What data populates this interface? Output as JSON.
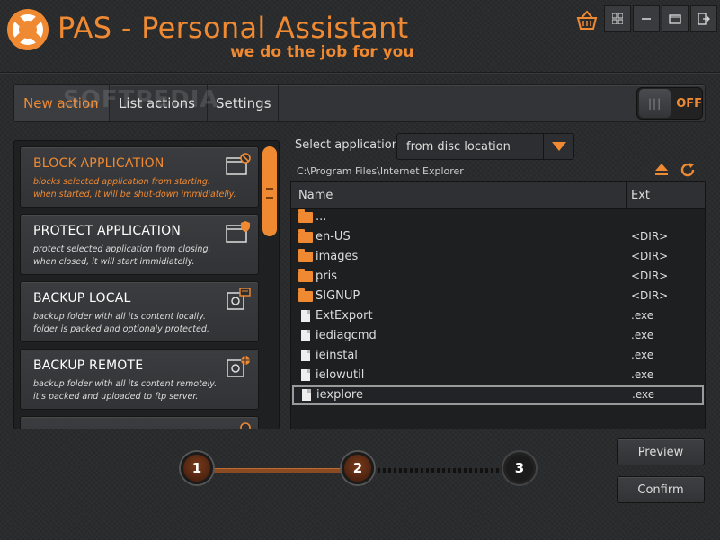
{
  "header": {
    "title": "PAS - Personal Assistant",
    "tagline": "we do the job for you"
  },
  "watermark": "SOFTPEDIA",
  "tabs": [
    {
      "label": "New action",
      "active": true
    },
    {
      "label": "List actions",
      "active": false
    },
    {
      "label": "Settings",
      "active": false
    }
  ],
  "toggle": {
    "state": "OFF",
    "grip": "|||"
  },
  "actions": [
    {
      "title": "BLOCK APPLICATION",
      "desc1": "blocks selected application from starting.",
      "desc2": "when started, it will be shut-down immidiatelly.",
      "icon": "window-block-icon",
      "selected": true
    },
    {
      "title": "PROTECT APPLICATION",
      "desc1": "protect selected application from closing.",
      "desc2": "when closed, it will start immidiatelly.",
      "icon": "window-shield-icon",
      "selected": false
    },
    {
      "title": "BACKUP LOCAL",
      "desc1": "backup folder with all its content locally.",
      "desc2": "folder is packed and optionaly protected.",
      "icon": "safe-local-icon",
      "selected": false
    },
    {
      "title": "BACKUP REMOTE",
      "desc1": "backup folder with all its content remotely.",
      "desc2": "it's packed and uploaded to ftp server.",
      "icon": "safe-remote-icon",
      "selected": false
    }
  ],
  "select": {
    "label": "Select application:",
    "value": "from disc location"
  },
  "path": "C:\\Program Files\\Internet Explorer",
  "filelist": {
    "columns": [
      "Name",
      "Ext"
    ],
    "rows": [
      {
        "name": "...",
        "ext": "",
        "type": "folder"
      },
      {
        "name": "en-US",
        "ext": "<DIR>",
        "type": "folder"
      },
      {
        "name": "images",
        "ext": "<DIR>",
        "type": "folder"
      },
      {
        "name": "pris",
        "ext": "<DIR>",
        "type": "folder"
      },
      {
        "name": "SIGNUP",
        "ext": "<DIR>",
        "type": "folder"
      },
      {
        "name": "ExtExport",
        "ext": ".exe",
        "type": "file"
      },
      {
        "name": "iediagcmd",
        "ext": ".exe",
        "type": "file"
      },
      {
        "name": "ieinstal",
        "ext": ".exe",
        "type": "file"
      },
      {
        "name": "ielowutil",
        "ext": ".exe",
        "type": "file"
      },
      {
        "name": "iexplore",
        "ext": ".exe",
        "type": "file",
        "selected": true
      }
    ]
  },
  "steps": [
    "1",
    "2",
    "3"
  ],
  "buttons": {
    "preview": "Preview",
    "confirm": "Confirm"
  },
  "window_buttons": [
    "grid-icon",
    "minimize-icon",
    "restore-icon",
    "exit-icon"
  ],
  "colors": {
    "accent": "#f08a32",
    "background": "#2a2b2d"
  }
}
